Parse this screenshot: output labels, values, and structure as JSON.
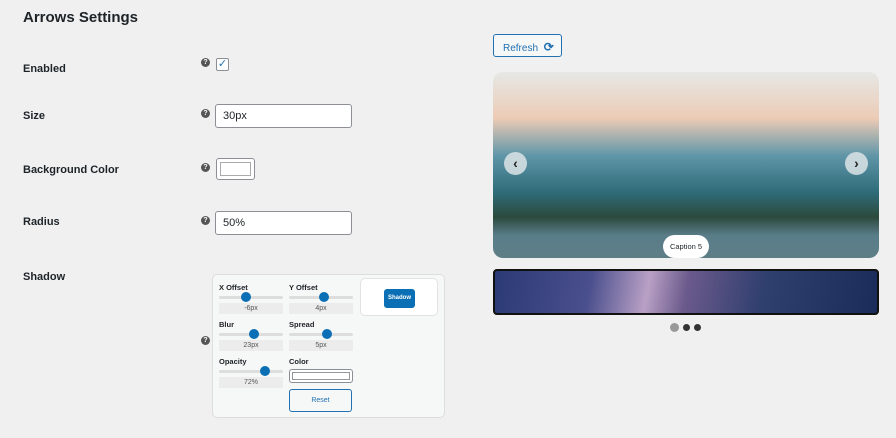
{
  "title": "Arrows Settings",
  "fields": {
    "enabled": "Enabled",
    "size": "Size",
    "bg": "Background Color",
    "radius": "Radius",
    "shadow": "Shadow"
  },
  "values": {
    "enabled": true,
    "size": "30px",
    "radius": "50%",
    "bg_color": "#ffffff"
  },
  "shadow": {
    "x_offset": {
      "label": "X Offset",
      "value": "-6px",
      "fraction": 0.42
    },
    "y_offset": {
      "label": "Y Offset",
      "value": "4px",
      "fraction": 0.54
    },
    "blur": {
      "label": "Blur",
      "value": "23px",
      "fraction": 0.55
    },
    "spread": {
      "label": "Spread",
      "value": "5px",
      "fraction": 0.6
    },
    "opacity": {
      "label": "Opacity",
      "value": "72%",
      "fraction": 0.72
    },
    "color_label": "Color",
    "preview_label": "Shadow",
    "reset": "Reset"
  },
  "preview": {
    "refresh": "Refresh",
    "caption": "Caption 5",
    "prev": "‹",
    "next": "›",
    "active_dot": 0,
    "dots": 3
  },
  "colors": {
    "accent": "#2271b1",
    "thumb": "#0a6fb5"
  }
}
